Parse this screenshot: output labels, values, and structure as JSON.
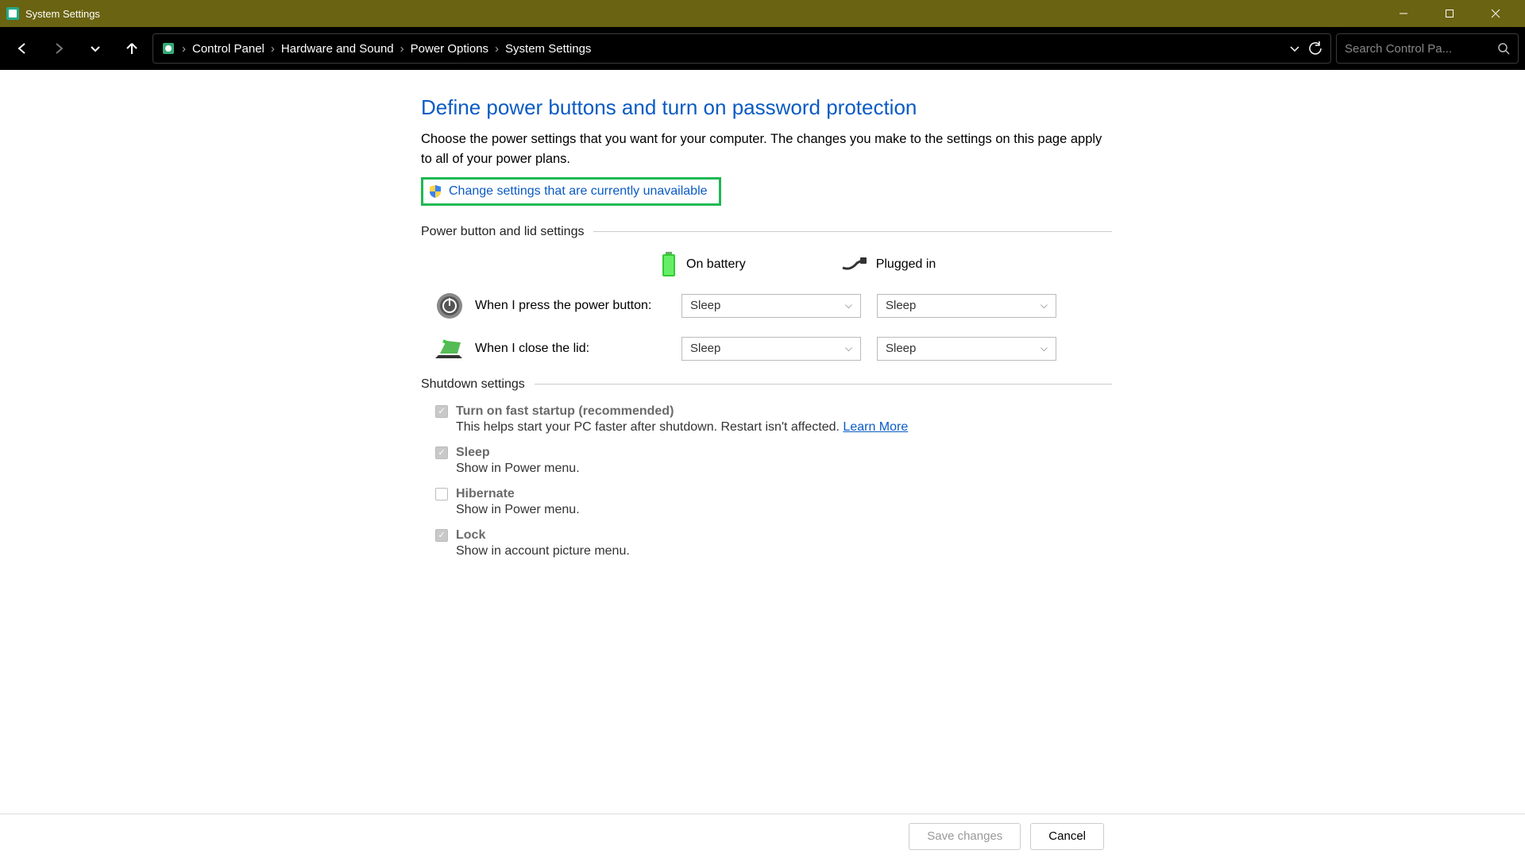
{
  "window": {
    "title": "System Settings"
  },
  "breadcrumb": {
    "items": [
      "Control Panel",
      "Hardware and Sound",
      "Power Options",
      "System Settings"
    ]
  },
  "search": {
    "placeholder": "Search Control Pa..."
  },
  "page": {
    "heading": "Define power buttons and turn on password protection",
    "description": "Choose the power settings that you want for your computer. The changes you make to the settings on this page apply to all of your power plans.",
    "change_link": "Change settings that are currently unavailable"
  },
  "sections": {
    "power_lid": "Power button and lid settings",
    "shutdown": "Shutdown settings"
  },
  "columns": {
    "battery": "On battery",
    "plugged": "Plugged in"
  },
  "rows": {
    "power_button": {
      "label": "When I press the power button:",
      "battery": "Sleep",
      "plugged": "Sleep"
    },
    "lid": {
      "label": "When I close the lid:",
      "battery": "Sleep",
      "plugged": "Sleep"
    }
  },
  "shutdown": {
    "fast": {
      "label": "Turn on fast startup (recommended)",
      "desc": "This helps start your PC faster after shutdown. Restart isn't affected. ",
      "learn": "Learn More"
    },
    "sleep": {
      "label": "Sleep",
      "desc": "Show in Power menu."
    },
    "hibernate": {
      "label": "Hibernate",
      "desc": "Show in Power menu."
    },
    "lock": {
      "label": "Lock",
      "desc": "Show in account picture menu."
    }
  },
  "footer": {
    "save": "Save changes",
    "cancel": "Cancel"
  }
}
